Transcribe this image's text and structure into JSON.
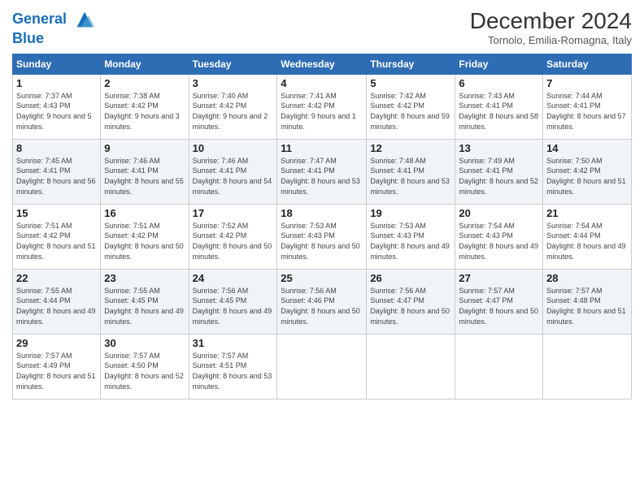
{
  "header": {
    "logo_line1": "General",
    "logo_line2": "Blue",
    "title": "December 2024",
    "location": "Tornolo, Emilia-Romagna, Italy"
  },
  "days_of_week": [
    "Sunday",
    "Monday",
    "Tuesday",
    "Wednesday",
    "Thursday",
    "Friday",
    "Saturday"
  ],
  "weeks": [
    [
      {
        "day": "1",
        "sunrise": "7:37 AM",
        "sunset": "4:43 PM",
        "daylight": "9 hours and 5 minutes."
      },
      {
        "day": "2",
        "sunrise": "7:38 AM",
        "sunset": "4:42 PM",
        "daylight": "9 hours and 3 minutes."
      },
      {
        "day": "3",
        "sunrise": "7:40 AM",
        "sunset": "4:42 PM",
        "daylight": "9 hours and 2 minutes."
      },
      {
        "day": "4",
        "sunrise": "7:41 AM",
        "sunset": "4:42 PM",
        "daylight": "9 hours and 1 minute."
      },
      {
        "day": "5",
        "sunrise": "7:42 AM",
        "sunset": "4:42 PM",
        "daylight": "8 hours and 59 minutes."
      },
      {
        "day": "6",
        "sunrise": "7:43 AM",
        "sunset": "4:41 PM",
        "daylight": "8 hours and 58 minutes."
      },
      {
        "day": "7",
        "sunrise": "7:44 AM",
        "sunset": "4:41 PM",
        "daylight": "8 hours and 57 minutes."
      }
    ],
    [
      {
        "day": "8",
        "sunrise": "7:45 AM",
        "sunset": "4:41 PM",
        "daylight": "8 hours and 56 minutes."
      },
      {
        "day": "9",
        "sunrise": "7:46 AM",
        "sunset": "4:41 PM",
        "daylight": "8 hours and 55 minutes."
      },
      {
        "day": "10",
        "sunrise": "7:46 AM",
        "sunset": "4:41 PM",
        "daylight": "8 hours and 54 minutes."
      },
      {
        "day": "11",
        "sunrise": "7:47 AM",
        "sunset": "4:41 PM",
        "daylight": "8 hours and 53 minutes."
      },
      {
        "day": "12",
        "sunrise": "7:48 AM",
        "sunset": "4:41 PM",
        "daylight": "8 hours and 53 minutes."
      },
      {
        "day": "13",
        "sunrise": "7:49 AM",
        "sunset": "4:41 PM",
        "daylight": "8 hours and 52 minutes."
      },
      {
        "day": "14",
        "sunrise": "7:50 AM",
        "sunset": "4:42 PM",
        "daylight": "8 hours and 51 minutes."
      }
    ],
    [
      {
        "day": "15",
        "sunrise": "7:51 AM",
        "sunset": "4:42 PM",
        "daylight": "8 hours and 51 minutes."
      },
      {
        "day": "16",
        "sunrise": "7:51 AM",
        "sunset": "4:42 PM",
        "daylight": "8 hours and 50 minutes."
      },
      {
        "day": "17",
        "sunrise": "7:52 AM",
        "sunset": "4:42 PM",
        "daylight": "8 hours and 50 minutes."
      },
      {
        "day": "18",
        "sunrise": "7:53 AM",
        "sunset": "4:43 PM",
        "daylight": "8 hours and 50 minutes."
      },
      {
        "day": "19",
        "sunrise": "7:53 AM",
        "sunset": "4:43 PM",
        "daylight": "8 hours and 49 minutes."
      },
      {
        "day": "20",
        "sunrise": "7:54 AM",
        "sunset": "4:43 PM",
        "daylight": "8 hours and 49 minutes."
      },
      {
        "day": "21",
        "sunrise": "7:54 AM",
        "sunset": "4:44 PM",
        "daylight": "8 hours and 49 minutes."
      }
    ],
    [
      {
        "day": "22",
        "sunrise": "7:55 AM",
        "sunset": "4:44 PM",
        "daylight": "8 hours and 49 minutes."
      },
      {
        "day": "23",
        "sunrise": "7:55 AM",
        "sunset": "4:45 PM",
        "daylight": "8 hours and 49 minutes."
      },
      {
        "day": "24",
        "sunrise": "7:56 AM",
        "sunset": "4:45 PM",
        "daylight": "8 hours and 49 minutes."
      },
      {
        "day": "25",
        "sunrise": "7:56 AM",
        "sunset": "4:46 PM",
        "daylight": "8 hours and 50 minutes."
      },
      {
        "day": "26",
        "sunrise": "7:56 AM",
        "sunset": "4:47 PM",
        "daylight": "8 hours and 50 minutes."
      },
      {
        "day": "27",
        "sunrise": "7:57 AM",
        "sunset": "4:47 PM",
        "daylight": "8 hours and 50 minutes."
      },
      {
        "day": "28",
        "sunrise": "7:57 AM",
        "sunset": "4:48 PM",
        "daylight": "8 hours and 51 minutes."
      }
    ],
    [
      {
        "day": "29",
        "sunrise": "7:57 AM",
        "sunset": "4:49 PM",
        "daylight": "8 hours and 51 minutes."
      },
      {
        "day": "30",
        "sunrise": "7:57 AM",
        "sunset": "4:50 PM",
        "daylight": "8 hours and 52 minutes."
      },
      {
        "day": "31",
        "sunrise": "7:57 AM",
        "sunset": "4:51 PM",
        "daylight": "8 hours and 53 minutes."
      },
      null,
      null,
      null,
      null
    ]
  ]
}
